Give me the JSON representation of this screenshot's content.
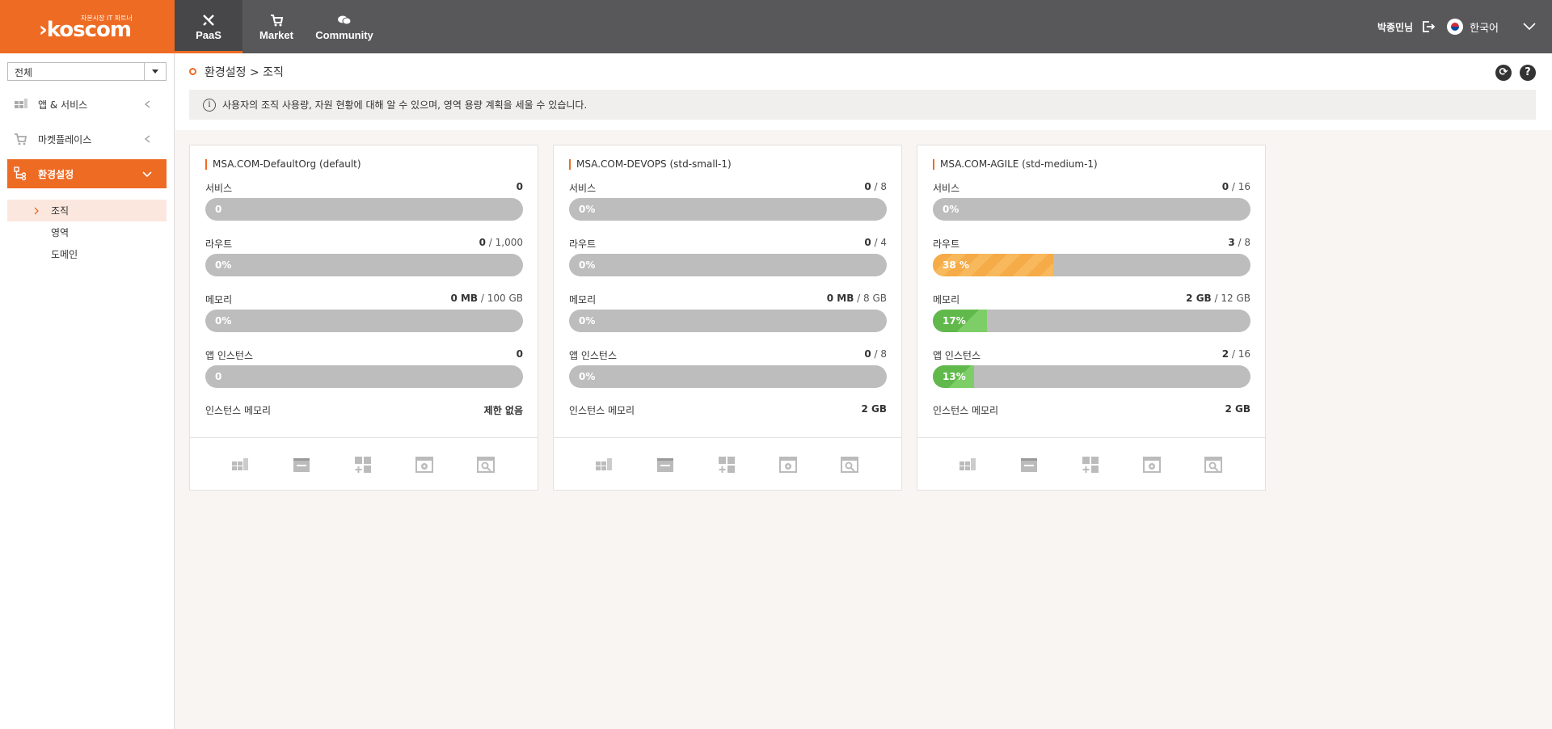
{
  "brand": {
    "tagline": "자본시장 IT 파트너",
    "name": "koscom",
    "logo_color": "#ee6b23"
  },
  "nav": [
    {
      "label": "PaaS",
      "icon": "tools-icon",
      "active": true
    },
    {
      "label": "Market",
      "icon": "cart-icon",
      "active": false
    },
    {
      "label": "Community",
      "icon": "chat-icon",
      "active": false
    }
  ],
  "user": {
    "name": "박종민님",
    "language": "한국어"
  },
  "sidebar": {
    "select_value": "전체",
    "items": [
      {
        "label": "앱 & 서비스",
        "icon": "apps-icon"
      },
      {
        "label": "마켓플레이스",
        "icon": "cart-icon"
      },
      {
        "label": "환경설정",
        "icon": "settings-tree-icon",
        "active": true
      }
    ],
    "subitems": [
      {
        "label": "조직",
        "active": true
      },
      {
        "label": "영역"
      },
      {
        "label": "도메인"
      }
    ]
  },
  "breadcrumb": "환경설정 > 조직",
  "info_text": "사용자의 조직 사용량, 자원 현황에 대해 알 수 있으며, 영역 용량 계획을 세울 수 있습니다.",
  "cards": [
    {
      "title": "MSA.COM-DefaultOrg (default)",
      "metrics": [
        {
          "label": "서비스",
          "used": "0",
          "limit": "",
          "bar_text": "0",
          "percent": 0,
          "color": ""
        },
        {
          "label": "라우트",
          "used": "0",
          "limit": " / 1,000",
          "bar_text": "0%",
          "percent": 0,
          "color": ""
        },
        {
          "label": "메모리",
          "used": "0 MB",
          "limit": " / 100 GB",
          "bar_text": "0%",
          "percent": 0,
          "color": ""
        },
        {
          "label": "앱 인스턴스",
          "used": "0",
          "limit": "",
          "bar_text": "0",
          "percent": 0,
          "color": ""
        }
      ],
      "instance_memory_label": "인스턴스 메모리",
      "instance_memory_value": "제한 없음"
    },
    {
      "title": "MSA.COM-DEVOPS (std-small-1)",
      "metrics": [
        {
          "label": "서비스",
          "used": "0",
          "limit": " / 8",
          "bar_text": "0%",
          "percent": 0,
          "color": ""
        },
        {
          "label": "라우트",
          "used": "0",
          "limit": " / 4",
          "bar_text": "0%",
          "percent": 0,
          "color": ""
        },
        {
          "label": "메모리",
          "used": "0 MB",
          "limit": " / 8 GB",
          "bar_text": "0%",
          "percent": 0,
          "color": ""
        },
        {
          "label": "앱 인스턴스",
          "used": "0",
          "limit": " / 8",
          "bar_text": "0%",
          "percent": 0,
          "color": ""
        }
      ],
      "instance_memory_label": "인스턴스 메모리",
      "instance_memory_value": "2 GB"
    },
    {
      "title": "MSA.COM-AGILE (std-medium-1)",
      "metrics": [
        {
          "label": "서비스",
          "used": "0",
          "limit": " / 16",
          "bar_text": "0%",
          "percent": 0,
          "color": ""
        },
        {
          "label": "라우트",
          "used": "3",
          "limit": " / 8",
          "bar_text": "38 %",
          "percent": 38,
          "color": "orange"
        },
        {
          "label": "메모리",
          "used": "2 GB",
          "limit": " / 12 GB",
          "bar_text": "17%",
          "percent": 17,
          "color": "green"
        },
        {
          "label": "앱 인스턴스",
          "used": "2",
          "limit": " / 16",
          "bar_text": "13%",
          "percent": 13,
          "color": "green"
        }
      ],
      "instance_memory_label": "인스턴스 메모리",
      "instance_memory_value": "2 GB"
    }
  ],
  "card_footer_icons": [
    "apps-icon",
    "service-icon",
    "add-app-icon",
    "settings-window-icon",
    "search-window-icon"
  ]
}
